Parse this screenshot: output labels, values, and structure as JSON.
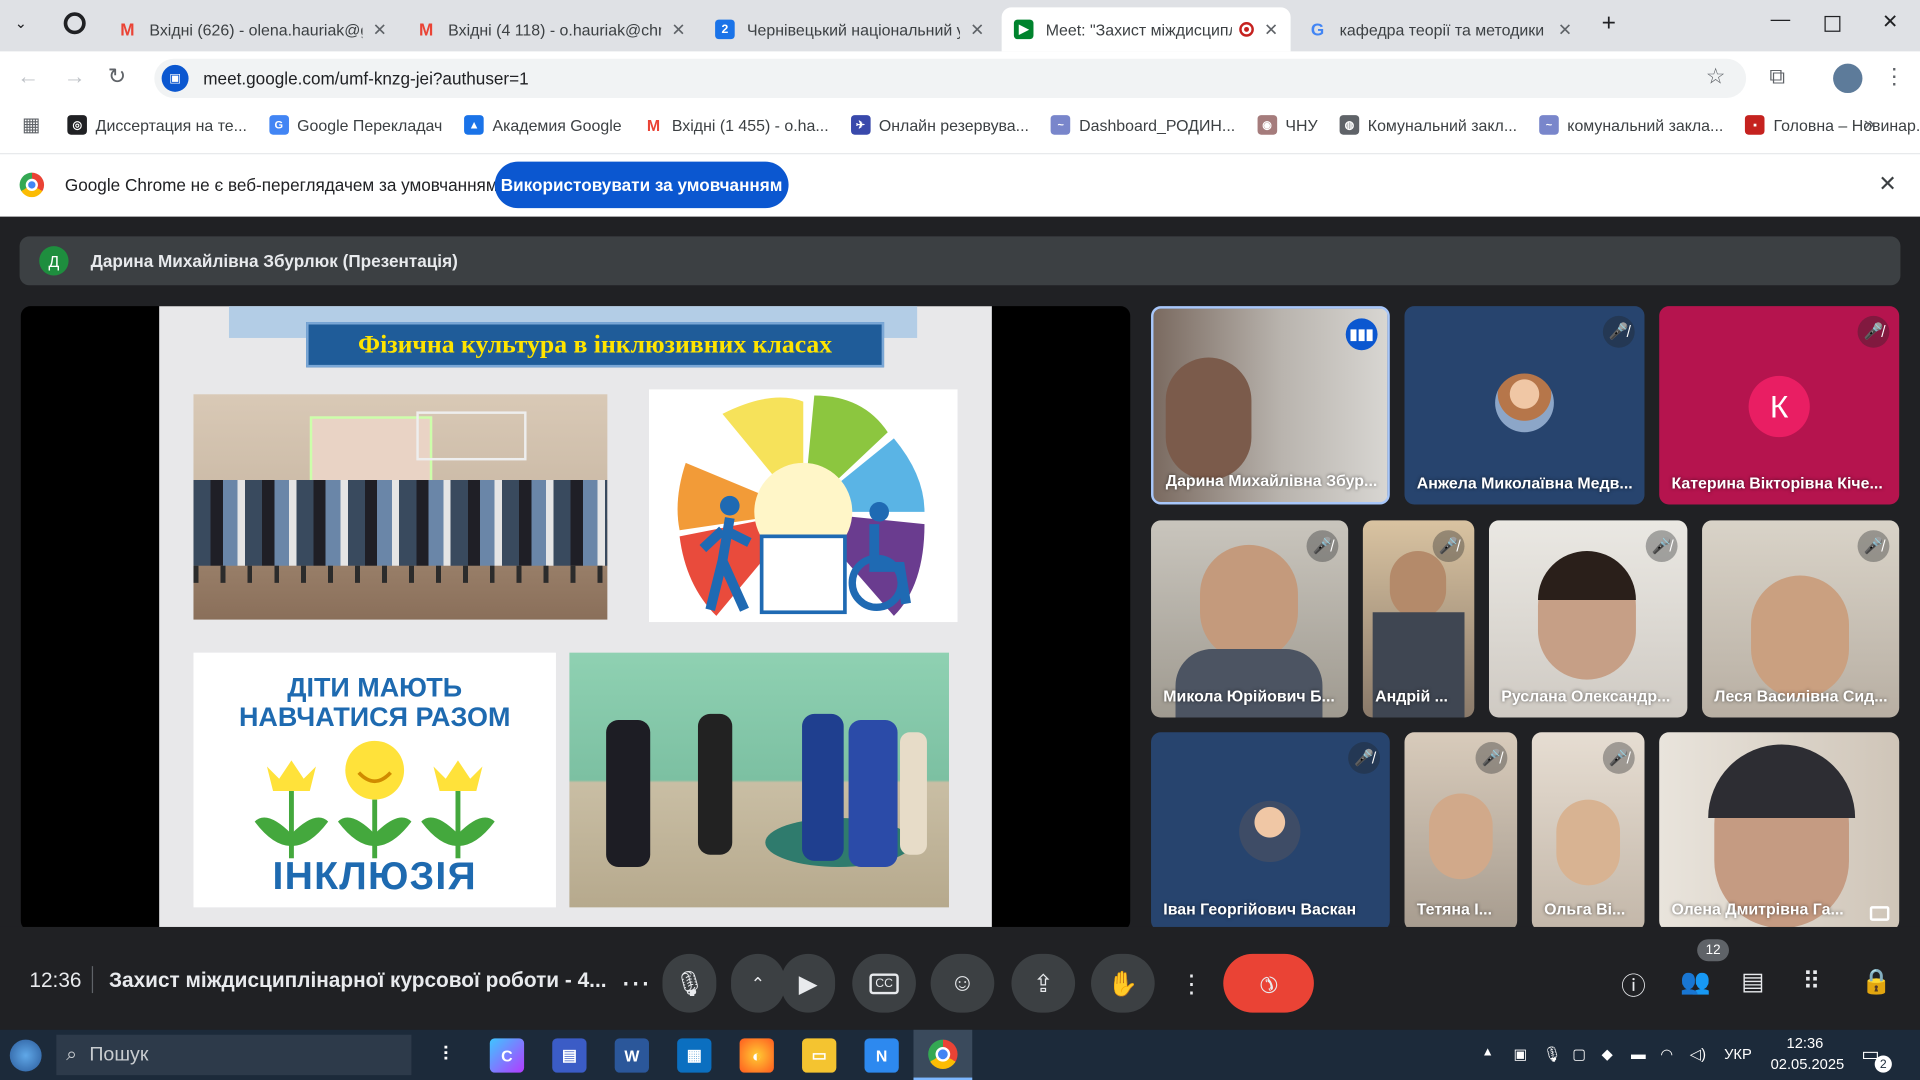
{
  "tabs": [
    {
      "title": "Вхідні (626) - olena.hauriak@gm",
      "icon": "gmail-icon"
    },
    {
      "title": "Вхідні (4 118) - o.hauriak@chnu",
      "icon": "gmail-icon"
    },
    {
      "title": "Чернівецький національний у",
      "icon": "moodle-icon"
    },
    {
      "title": "Meet: \"Захист міждисциплі",
      "icon": "meet-icon"
    },
    {
      "title": "кафедра теорії та методики ф",
      "icon": "google-icon"
    }
  ],
  "address": {
    "url": "meet.google.com/umf-knzg-jei?authuser=1"
  },
  "bookmarks": [
    "Диссертация на те...",
    "Google Перекладач",
    "Академия Google",
    "Вхідні (1 455) - o.ha...",
    "Онлайн резервува...",
    "Dashboard_РОДИН...",
    "ЧНУ",
    "Комунальний закл...",
    "комунальний закла...",
    "Головна – Новинар..."
  ],
  "infobar": {
    "message": "Google Chrome не є веб-переглядачем за умовчанням",
    "button": "Використовувати за умовчанням"
  },
  "presenter": {
    "initial": "Д",
    "label": "Дарина Михайлівна Збурлюк (Презентація)"
  },
  "slide": {
    "title": "Фізична культура в інклюзивних класах",
    "poster_line1": "ДІТИ МАЮТЬ",
    "poster_line2": "НАВЧАТИСЯ РАЗОМ",
    "poster_word": "ІНКЛЮЗІЯ"
  },
  "participants": [
    {
      "name": "Дарина Михайлівна Збур...",
      "speaking": true
    },
    {
      "name": "Анжела Миколаївна Медв...",
      "muted": true
    },
    {
      "name": "Катерина Вікторівна Кіче...",
      "muted": true,
      "initial": "К"
    },
    {
      "name": "Микола Юрійович Б...",
      "muted": true
    },
    {
      "name": "Андрій ...",
      "muted": true
    },
    {
      "name": "Руслана Олександр...",
      "muted": true
    },
    {
      "name": "Леся Василівна Сид...",
      "muted": true
    },
    {
      "name": "Іван Георгійович Васкан",
      "muted": true
    },
    {
      "name": "Тетяна І...",
      "muted": true
    },
    {
      "name": "Ольга Ві...",
      "muted": true
    },
    {
      "name": "Олена Дмитрівна Га..."
    }
  ],
  "controls": {
    "time": "12:36",
    "meeting_title": "Захист міждисциплінарної курсової роботи - 4...",
    "people_count": "12"
  },
  "taskbar": {
    "search": "Пошук",
    "lang": "УКР",
    "time": "12:36",
    "date": "02.05.2025",
    "notif": "2"
  },
  "colors": {
    "accent": "#0b57d0",
    "end_call": "#ea4335",
    "meet_bg": "#202124"
  }
}
